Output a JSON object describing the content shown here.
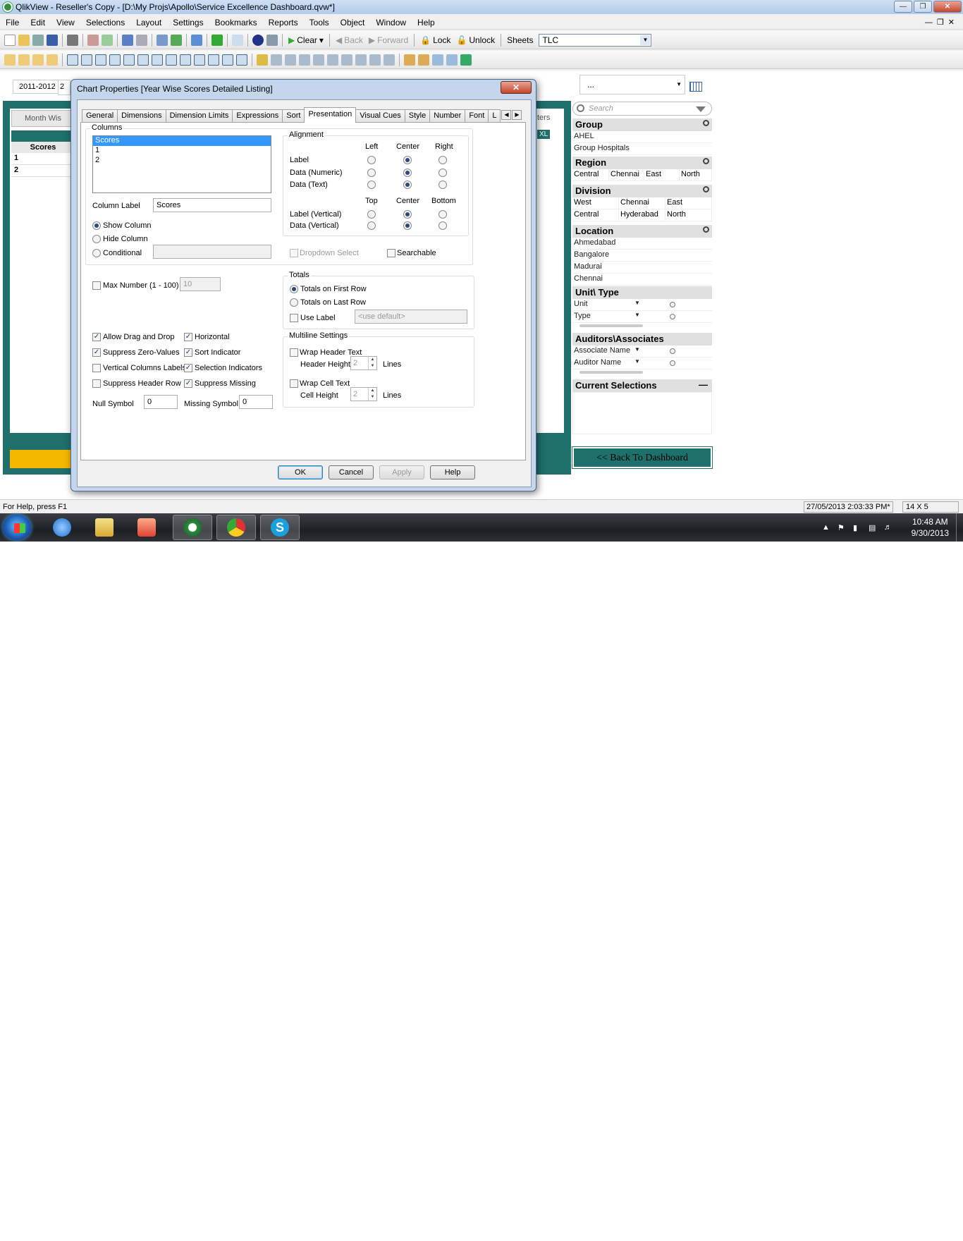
{
  "window": {
    "title": "QlikView - Reseller's Copy - [D:\\My Projs\\Apollo\\Service Excellence Dashboard.qvw*]"
  },
  "menu": [
    "File",
    "Edit",
    "View",
    "Selections",
    "Layout",
    "Settings",
    "Bookmarks",
    "Reports",
    "Tools",
    "Object",
    "Window",
    "Help"
  ],
  "toolbar": {
    "clear": "Clear",
    "back": "Back",
    "forward": "Forward",
    "lock": "Lock",
    "unlock": "Unlock",
    "sheets_label": "Sheets",
    "sheets_value": "TLC"
  },
  "sheet": {
    "year": "2011-2012",
    "year2": "2",
    "month_tab": "Month Wis",
    "scores_header": "Scores",
    "rows": [
      "1",
      "2"
    ],
    "right_label": "ters",
    "xl_label": "XL"
  },
  "right_panel": {
    "top_select": "...",
    "search_placeholder": "Search",
    "group": {
      "caption": "Group",
      "items": [
        "AHEL",
        "Group Hospitals"
      ]
    },
    "region": {
      "caption": "Region",
      "items": [
        "Central",
        "Chennai",
        "East",
        "North"
      ]
    },
    "division": {
      "caption": "Division",
      "items": [
        "West",
        "Chennai",
        "East",
        "Central",
        "Hyderabad",
        "North"
      ]
    },
    "location": {
      "caption": "Location",
      "items": [
        "Ahmedabad",
        "Bangalore",
        "Madurai",
        "Chennai"
      ]
    },
    "unit_type": {
      "caption": "Unit\\ Type",
      "items": [
        "Unit",
        "Type"
      ]
    },
    "auditors": {
      "caption": "Auditors\\Associates",
      "items": [
        "Associate Name",
        "Auditor Name"
      ]
    },
    "current_selections": "Current Selections",
    "back_button": "<< Back To Dashboard"
  },
  "dialog": {
    "title": "Chart Properties [Year Wise Scores Detailed Listing]",
    "tabs": [
      "General",
      "Dimensions",
      "Dimension Limits",
      "Expressions",
      "Sort",
      "Presentation",
      "Visual Cues",
      "Style",
      "Number",
      "Font",
      "L"
    ],
    "columns_label": "Columns",
    "columns": [
      "Scores",
      "1",
      "2"
    ],
    "column_label_caption": "Column Label",
    "column_label_value": "Scores",
    "show_column": "Show Column",
    "hide_column": "Hide Column",
    "conditional": "Conditional",
    "alignment": "Alignment",
    "align_cols": [
      "Left",
      "Center",
      "Right"
    ],
    "align_rows": [
      "Label",
      "Data (Numeric)",
      "Data (Text)"
    ],
    "valign_cols": [
      "Top",
      "Center",
      "Bottom"
    ],
    "valign_rows": [
      "Label (Vertical)",
      "Data (Vertical)"
    ],
    "dropdown_select": "Dropdown Select",
    "searchable": "Searchable",
    "max_number": "Max Number (1 - 100)",
    "max_number_value": "10",
    "totals": "Totals",
    "totals_first": "Totals on First Row",
    "totals_last": "Totals on Last Row",
    "use_label": "Use Label",
    "use_label_placeholder": "<use default>",
    "allow_drag": "Allow Drag and Drop",
    "suppress_zero": "Suppress Zero-Values",
    "vertical_columns": "Vertical Columns Labels",
    "suppress_header": "Suppress Header Row",
    "horizontal": "Horizontal",
    "sort_indicator": "Sort Indicator",
    "selection_indicators": "Selection Indicators",
    "suppress_missing": "Suppress Missing",
    "null_symbol": "Null Symbol",
    "null_value": "0",
    "missing_symbol": "Missing Symbol",
    "missing_value": "0",
    "multiline": "Multiline Settings",
    "wrap_header": "Wrap Header Text",
    "header_height": "Header Height",
    "header_height_value": "2",
    "lines1": "Lines",
    "wrap_cell": "Wrap Cell Text",
    "cell_height": "Cell Height",
    "cell_height_value": "2",
    "lines2": "Lines",
    "ok": "OK",
    "cancel": "Cancel",
    "apply": "Apply",
    "help": "Help"
  },
  "status": {
    "help": "For Help, press F1",
    "datetime": "27/05/2013 2:03:33 PM*",
    "dims": "14 X 5"
  },
  "tray": {
    "time": "10:48 AM",
    "date": "9/30/2013"
  }
}
